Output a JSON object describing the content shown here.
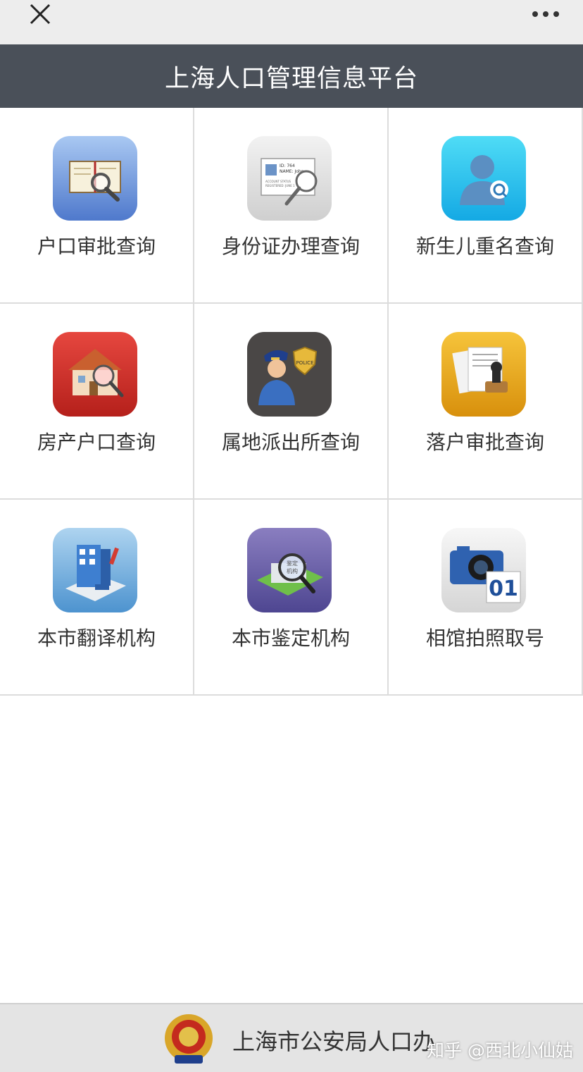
{
  "topbar": {
    "close_icon": "close-icon",
    "more_icon": "more-dots-icon"
  },
  "header": {
    "title": "上海人口管理信息平台"
  },
  "services": [
    {
      "label": "户口审批查询",
      "icon": "book-magnifier-icon"
    },
    {
      "label": "身份证办理查询",
      "icon": "id-card-magnifier-icon",
      "card_text": [
        "ID: 764",
        "NAME: John",
        "ACCOUNT STATUS",
        "REGISTERED: JUNE 1"
      ]
    },
    {
      "label": "新生儿重名查询",
      "icon": "person-search-icon"
    },
    {
      "label": "房产户口查询",
      "icon": "house-magnifier-icon"
    },
    {
      "label": "属地派出所查询",
      "icon": "police-officer-icon",
      "badge_text": "POLICE"
    },
    {
      "label": "落户审批查询",
      "icon": "documents-stamp-icon"
    },
    {
      "label": "本市翻译机构",
      "icon": "building-pencil-icon"
    },
    {
      "label": "本市鉴定机构",
      "icon": "institution-magnifier-icon",
      "lens_text": [
        "鉴定",
        "机构"
      ]
    },
    {
      "label": "相馆拍照取号",
      "icon": "camera-number-icon",
      "number_text": "01"
    }
  ],
  "footer": {
    "text": "上海市公安局人口办",
    "emblem_icon": "police-emblem-icon"
  },
  "watermark": {
    "text": "知乎 @西北小仙姑"
  },
  "colors": {
    "header_bg": "#4a5059",
    "topbar_bg": "#ededed",
    "footer_bg": "#e4e4e4"
  }
}
